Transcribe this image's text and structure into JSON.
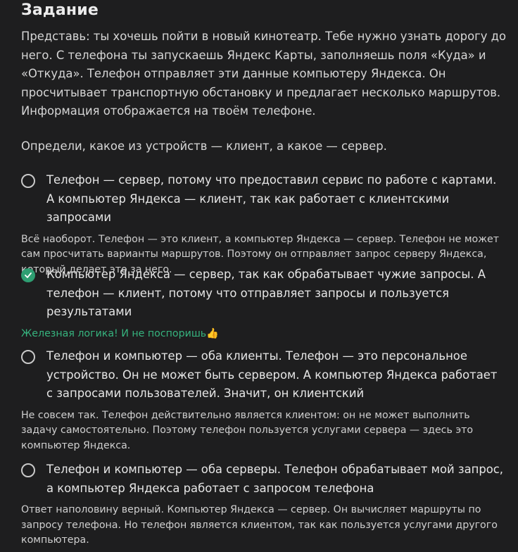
{
  "title": "Задание",
  "intro": "Представь: ты хочешь пойти в новый кинотеатр. Тебе нужно узнать дорогу до него. С телефона ты запускаешь Яндекс Карты, заполняешь поля «Куда» и «Откуда». Телефон отправляет эти данные компьютеру Яндекса. Он просчитывает транспортную обстановку и предлагает несколько маршрутов. Информация отображается на твоём телефоне.",
  "question": "Определи, какое из устройств — клиент, а какое — сервер.",
  "options": [
    {
      "text": "Телефон — сервер, потому что предоставил сервис по работе с картами. А компьютер Яндекса — клиент, так как работает с клиентскими запросами",
      "feedback": "Всё наоборот. Телефон — это клиент, а компьютер Яндекса — сервер. Телефон не может сам просчитать варианты маршрутов. Поэтому он отправляет запрос серверу Яндекса, который делает это за него.",
      "selected": false
    },
    {
      "text": "Компьютер Яндекса — сервер, так как обрабатывает чужие запросы. А телефон — клиент, потому что отправляет запросы и пользуется результатами",
      "feedback": "Железная логика! И не поспоришь👍",
      "selected": true
    },
    {
      "text": "Телефон и компьютер — оба клиенты. Телефон — это персональное устройство. Он не может быть сервером. А компьютер Яндекса работает с запросами пользователей. Значит, он клиентский",
      "feedback": "Не совсем так. Телефон действительно является клиентом: он не может выполнить задачу самостоятельно. Поэтому телефон пользуется услугами сервера — здесь это компьютер Яндекса.",
      "selected": false
    },
    {
      "text": "Телефон и компьютер — оба серверы. Телефон обрабатывает мой запрос, а компьютер Яндекса работает с запросом телефона",
      "feedback": "Ответ наполовину верный. Компьютер Яндекса — сервер. Он вычисляет маршруты по запросу телефона. Но телефон является клиентом, так как пользуется услугами другого компьютера.",
      "selected": false
    }
  ],
  "colors": {
    "background": "#1e1e1f",
    "correct": "#2e9e72",
    "correct_text": "#36b37e"
  },
  "icons": {
    "unchecked": "radio-unchecked-icon",
    "checked": "checkmark-icon"
  }
}
